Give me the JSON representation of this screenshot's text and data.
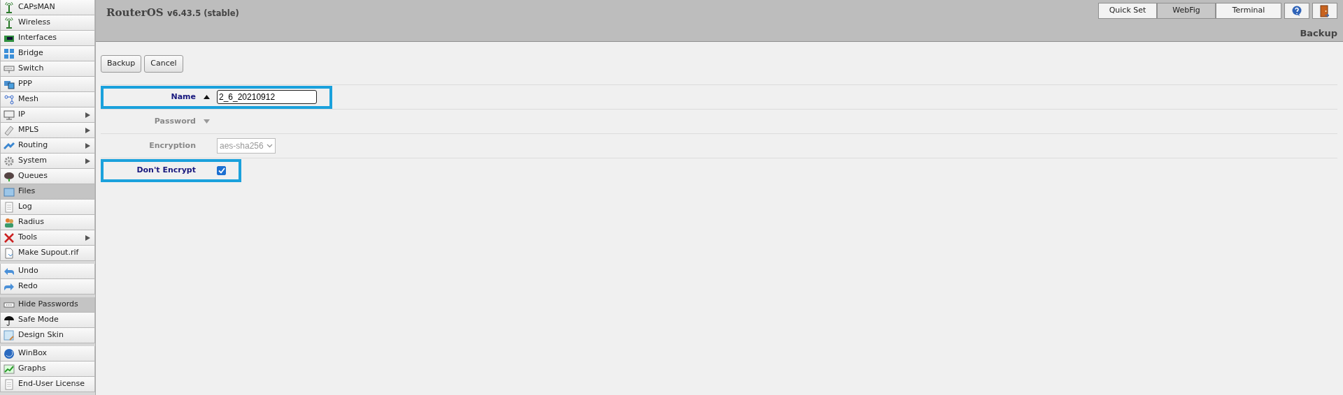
{
  "sidebar": {
    "groups": [
      {
        "items": [
          {
            "label": "CAPsMAN",
            "submenu": false,
            "selected": false
          },
          {
            "label": "Wireless",
            "submenu": false,
            "selected": false
          },
          {
            "label": "Interfaces",
            "submenu": false,
            "selected": false
          },
          {
            "label": "Bridge",
            "submenu": false,
            "selected": false
          },
          {
            "label": "Switch",
            "submenu": false,
            "selected": false
          },
          {
            "label": "PPP",
            "submenu": false,
            "selected": false
          },
          {
            "label": "Mesh",
            "submenu": false,
            "selected": false
          },
          {
            "label": "IP",
            "submenu": true,
            "selected": false
          },
          {
            "label": "MPLS",
            "submenu": true,
            "selected": false
          },
          {
            "label": "Routing",
            "submenu": true,
            "selected": false
          },
          {
            "label": "System",
            "submenu": true,
            "selected": false
          },
          {
            "label": "Queues",
            "submenu": false,
            "selected": false
          },
          {
            "label": "Files",
            "submenu": false,
            "selected": true
          },
          {
            "label": "Log",
            "submenu": false,
            "selected": false
          },
          {
            "label": "Radius",
            "submenu": false,
            "selected": false
          },
          {
            "label": "Tools",
            "submenu": true,
            "selected": false
          },
          {
            "label": "Make Supout.rif",
            "submenu": false,
            "selected": false
          }
        ]
      },
      {
        "items": [
          {
            "label": "Undo",
            "submenu": false,
            "selected": false
          },
          {
            "label": "Redo",
            "submenu": false,
            "selected": false
          }
        ]
      },
      {
        "items": [
          {
            "label": "Hide Passwords",
            "submenu": false,
            "selected": true
          },
          {
            "label": "Safe Mode",
            "submenu": false,
            "selected": false
          },
          {
            "label": "Design Skin",
            "submenu": false,
            "selected": false
          }
        ]
      },
      {
        "items": [
          {
            "label": "WinBox",
            "submenu": false,
            "selected": false
          },
          {
            "label": "Graphs",
            "submenu": false,
            "selected": false
          },
          {
            "label": "End-User License",
            "submenu": false,
            "selected": false
          }
        ]
      }
    ]
  },
  "header": {
    "product": "RouterOS",
    "version": "v6.43.5 (stable)",
    "page_title": "Backup",
    "mode_tabs": [
      {
        "label": "Quick Set",
        "selected": false
      },
      {
        "label": "WebFig",
        "selected": true
      },
      {
        "label": "Terminal",
        "selected": false
      }
    ]
  },
  "actions": [
    "Backup",
    "Cancel"
  ],
  "fields": [
    {
      "kind": "text",
      "label": "Name",
      "value": "2_6_20210912",
      "expanded": true,
      "disabled": false,
      "highlighted": true
    },
    {
      "kind": "collapsed",
      "label": "Password",
      "expanded": false,
      "disabled": true,
      "highlighted": false
    },
    {
      "kind": "select",
      "label": "Encryption",
      "value": "aes-sha256",
      "disabled": true,
      "highlighted": false
    },
    {
      "kind": "checkbox",
      "label": "Don't Encrypt",
      "checked": true,
      "disabled": false,
      "highlighted": true
    }
  ]
}
